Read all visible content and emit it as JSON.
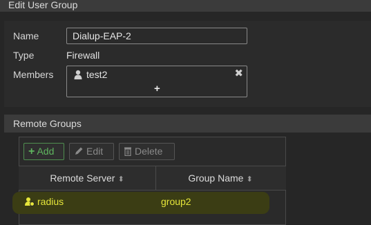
{
  "window": {
    "title": "Edit User Group"
  },
  "form": {
    "name_label": "Name",
    "name_value": "Dialup-EAP-2",
    "type_label": "Type",
    "type_value": "Firewall",
    "members_label": "Members",
    "members": [
      {
        "name": "test2",
        "icon": "user-icon"
      }
    ],
    "remove_glyph": "✖",
    "add_glyph": "+"
  },
  "remote_groups": {
    "title": "Remote Groups",
    "toolbar": {
      "add": "Add",
      "edit": "Edit",
      "delete": "Delete"
    },
    "columns": [
      "Remote Server",
      "Group Name"
    ],
    "sort_glyph": "⬍",
    "rows": [
      {
        "server": "radius",
        "group": "group2",
        "icon": "radius-server-icon"
      }
    ],
    "highlight_color": "#3b3d14"
  },
  "colors": {
    "accent_green": "#5fb55f",
    "row_text": "#e6e63a"
  }
}
